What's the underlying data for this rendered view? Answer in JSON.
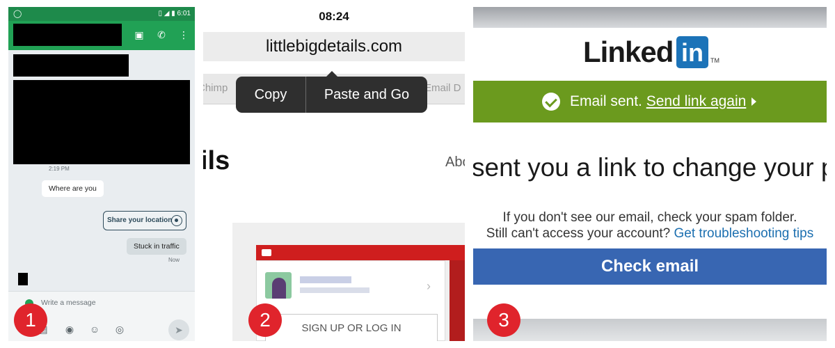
{
  "panel1": {
    "status_time": "6:01",
    "messages": {
      "timestamp": "2:19 PM",
      "incoming": "Where are you",
      "share_location": "Share your location",
      "outgoing": "Stuck in traffic",
      "outgoing_time": "Now"
    },
    "compose_placeholder": "Write a message",
    "icons": [
      "attach-icon",
      "gallery-icon",
      "camera-icon",
      "sticker-icon",
      "location-icon",
      "send-icon"
    ]
  },
  "panel2": {
    "time": "08:24",
    "url": "littlebigdetails.com",
    "tab_left": "Chimp",
    "tab_right": "Email D",
    "menu": {
      "copy": "Copy",
      "paste_and_go": "Paste and Go"
    },
    "page_heading": "ils",
    "nav_about": "Abo",
    "signup_button": "SIGN UP OR LOG IN"
  },
  "panel3": {
    "logo_word": "Linked",
    "logo_box": "in",
    "logo_tm": "TM",
    "banner_text": "Email sent.",
    "banner_link": "Send link again",
    "heading": "sent you a link to change your pa",
    "para1": "If you don't see our email, check your spam folder.",
    "para2_text": "Still can't access your account?",
    "para2_link": "Get troubleshooting tips",
    "button": "Check email"
  },
  "badges": [
    "1",
    "2",
    "3"
  ],
  "colors": {
    "android_green": "#21a155",
    "android_green_dark": "#1e8a4b",
    "ios_menu": "#2f2f2f",
    "linkedin_blue": "#1c73b8",
    "linkedin_green": "#6b9a1e",
    "check_email_blue": "#3866b2",
    "badge_red": "#e0242c"
  }
}
